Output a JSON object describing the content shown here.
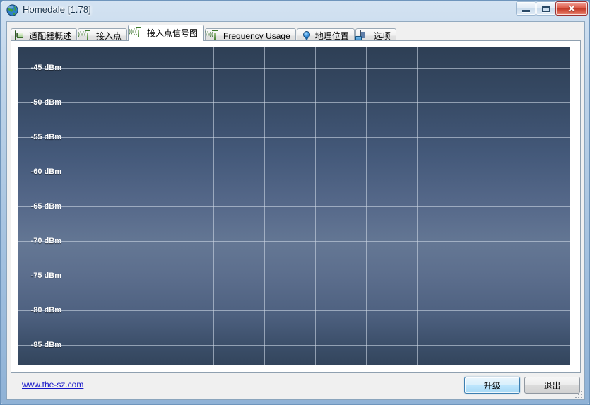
{
  "window": {
    "title": "Homedale [1.78]",
    "icon": "globe-icon",
    "controls": {
      "minimize": "–",
      "maximize": "□",
      "close": "✕"
    }
  },
  "tabs": [
    {
      "label": "适配器概述",
      "icon": "adapter-icon",
      "active": false
    },
    {
      "label": "接入点",
      "icon": "wifi-icon",
      "active": false
    },
    {
      "label": "接入点信号图",
      "icon": "wifi-icon",
      "active": true
    },
    {
      "label": "Frequency Usage",
      "icon": "wifi-icon",
      "active": false
    },
    {
      "label": "地理位置",
      "icon": "map-pin-icon",
      "active": false
    },
    {
      "label": "选项",
      "icon": "options-icon",
      "active": false
    }
  ],
  "footer": {
    "link": "www.the-sz.com",
    "upgrade_label": "升级",
    "exit_label": "退出"
  },
  "colors": {
    "chart_top": "#2e3f55",
    "chart_mid": "#647794",
    "chart_bottom": "#33455c",
    "grid": "#cdd7e4",
    "link": "#1414c8",
    "accent": "#3c7fb1"
  },
  "chart_data": {
    "type": "line",
    "title": "",
    "xlabel": "",
    "ylabel": "",
    "series": [],
    "x": [],
    "ylim": [
      -88,
      -42
    ],
    "yticks": [
      -45,
      -50,
      -55,
      -60,
      -65,
      -70,
      -75,
      -80,
      -85
    ],
    "ytick_labels": [
      "-45 dBm",
      "-50 dBm",
      "-55 dBm",
      "-60 dBm",
      "-65 dBm",
      "-70 dBm",
      "-75 dBm",
      "-80 dBm",
      "-85 dBm"
    ],
    "xtick_labels": [],
    "grid": true,
    "legend": "none",
    "note": "Empty signal-strength plot: no access point traces drawn"
  }
}
